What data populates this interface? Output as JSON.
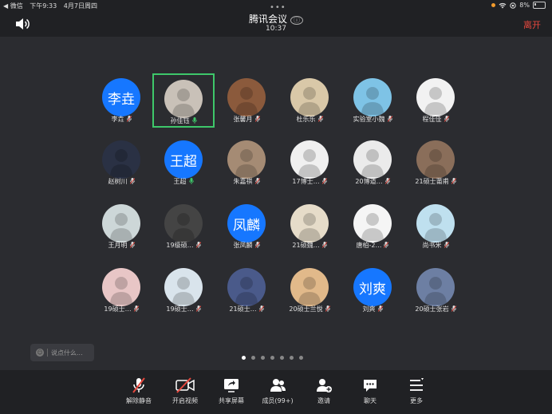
{
  "status_bar": {
    "back_app": "◀ 微信",
    "time": "下午9:33",
    "date": "4月7日周四",
    "battery": "8%"
  },
  "header": {
    "grabber": "•••",
    "title": "腾讯会议",
    "info_icon": "ⓘ",
    "clock": "10:37",
    "leave_label": "离开"
  },
  "participants": [
    {
      "name": "李垚",
      "avatar_text": "李垚",
      "avatar_color": "#1677ff"
    },
    {
      "name": "孙佳钰",
      "avatar_color": "#c9c1b8",
      "active": true,
      "mic": "on"
    },
    {
      "name": "张馨月",
      "avatar_color": "#8b5a3c"
    },
    {
      "name": "杜乐乐",
      "avatar_color": "#d9c8a8"
    },
    {
      "name": "实验室小魏",
      "avatar_color": "#7ec3e6"
    },
    {
      "name": "程佳佳",
      "avatar_color": "#f2f2f2"
    },
    {
      "name": "赵树川",
      "avatar_color": "#2a3144"
    },
    {
      "name": "王超",
      "avatar_text": "王超",
      "avatar_color": "#1677ff",
      "mic": "on"
    },
    {
      "name": "朱嘉祺",
      "avatar_color": "#a58b74"
    },
    {
      "name": "17博士…",
      "avatar_color": "#f0f0f0"
    },
    {
      "name": "20博道…",
      "avatar_color": "#ebebeb"
    },
    {
      "name": "21硕士莆甫",
      "avatar_color": "#8a6e5a"
    },
    {
      "name": "王月明",
      "avatar_color": "#cdd7d8"
    },
    {
      "name": "19级硕…",
      "avatar_color": "#444"
    },
    {
      "name": "张凤麟",
      "avatar_text": "凤麟",
      "avatar_color": "#1677ff"
    },
    {
      "name": "21硕魏…",
      "avatar_color": "#e6dcc9"
    },
    {
      "name": "唐柏-2…",
      "avatar_color": "#f5f5f5"
    },
    {
      "name": "尚书米",
      "avatar_color": "#bfe0ef"
    },
    {
      "name": "19硕士…",
      "avatar_color": "#e8c6c6"
    },
    {
      "name": "19硕士…",
      "avatar_color": "#d9e4ec"
    },
    {
      "name": "21硕士…",
      "avatar_color": "#4a5a8a"
    },
    {
      "name": "20硕士兰悦",
      "avatar_color": "#e1b98a"
    },
    {
      "name": "刘爽",
      "avatar_text": "刘爽",
      "avatar_color": "#1677ff"
    },
    {
      "name": "20硕士张岩",
      "avatar_color": "#6d7fa3"
    }
  ],
  "chat": {
    "placeholder": "说点什么..."
  },
  "pager": {
    "total_pages": 7,
    "current_page": 1
  },
  "toolbar": {
    "unmute": "解除静音",
    "start_video": "开启视频",
    "share_screen": "共享屏幕",
    "members": "成员(99+)",
    "invite": "邀请",
    "chat": "聊天",
    "more": "更多"
  },
  "colors": {
    "accent_blue": "#1677ff",
    "leave_red": "#e8483e",
    "active_border": "#3ec86a",
    "muted_red": "#e8483e"
  }
}
